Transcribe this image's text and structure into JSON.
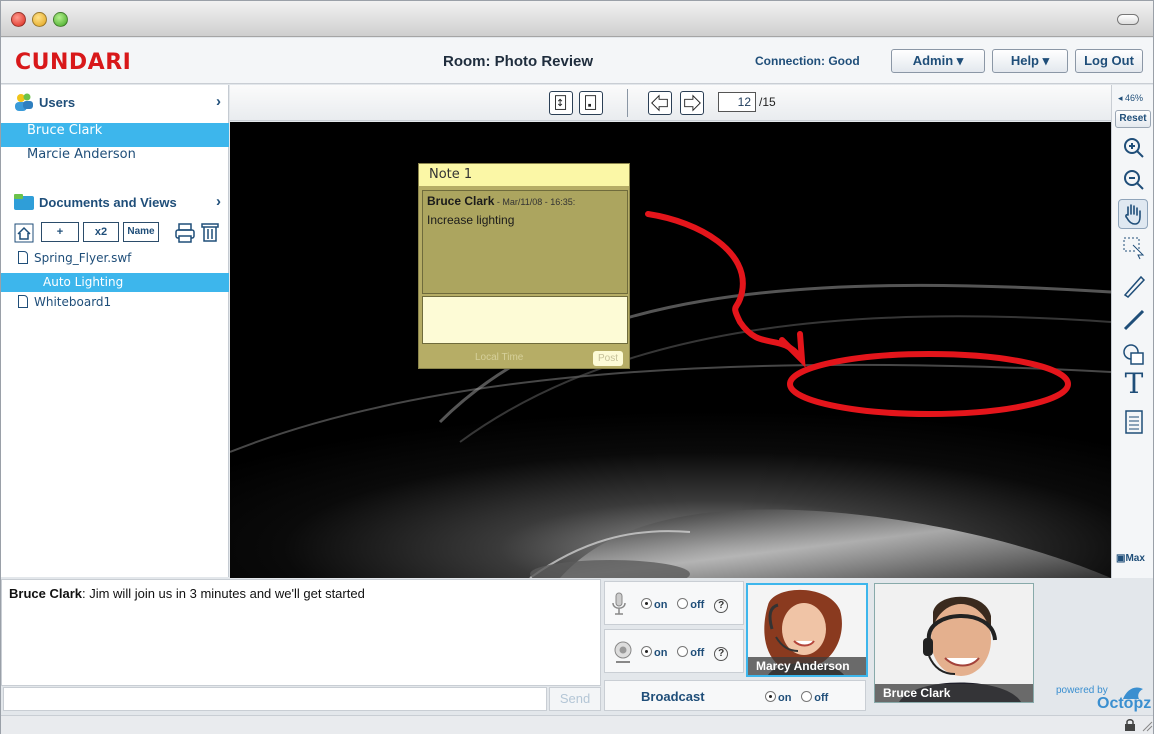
{
  "header": {
    "logo": "CUNDARI",
    "room_title": "Room: Photo Review",
    "connection": "Connection: Good",
    "admin_label": "Admin",
    "help_label": "Help",
    "logout_label": "Log Out"
  },
  "sidebar": {
    "users_label": "Users",
    "users": [
      {
        "name": "Bruce Clark",
        "selected": true
      },
      {
        "name": "Marcie Anderson",
        "selected": false
      }
    ],
    "documents_label": "Documents and Views",
    "doc_tools": {
      "add": "+",
      "x2": "x2",
      "name": "Name"
    },
    "documents": [
      {
        "name": "Spring_Flyer.swf",
        "type": "file"
      },
      {
        "name": "Auto Lighting",
        "type": "view",
        "selected": true
      },
      {
        "name": "Whiteboard1",
        "type": "file"
      }
    ]
  },
  "viewer": {
    "page_current": "12",
    "page_total": "/15",
    "zoom_pct": "◂ 46%",
    "reset_label": "Reset",
    "max_label": "Max"
  },
  "note": {
    "title": "Note 1",
    "author": "Bruce Clark",
    "timestamp": " - Mar/11/08 - 16:35:",
    "text": "Increase lighting",
    "time_label": "Local Time",
    "post_label": "Post"
  },
  "chat": {
    "sender": "Bruce Clark",
    "message": ": Jim will join us in 3 minutes and we'll get started",
    "send_label": "Send"
  },
  "media": {
    "mic_on": "on",
    "mic_off": "off",
    "cam_on": "on",
    "cam_off": "off",
    "broadcast_label": "Broadcast",
    "broadcast_on": "on",
    "broadcast_off": "off"
  },
  "videos": [
    {
      "name": "Marcy Anderson"
    },
    {
      "name": "Bruce Clark"
    }
  ],
  "branding": {
    "powered_by": "powered by",
    "octopz": "Octopz"
  },
  "colors": {
    "accent": "#3db6ec",
    "logo": "#d8181a",
    "annotation": "#e4151b"
  }
}
